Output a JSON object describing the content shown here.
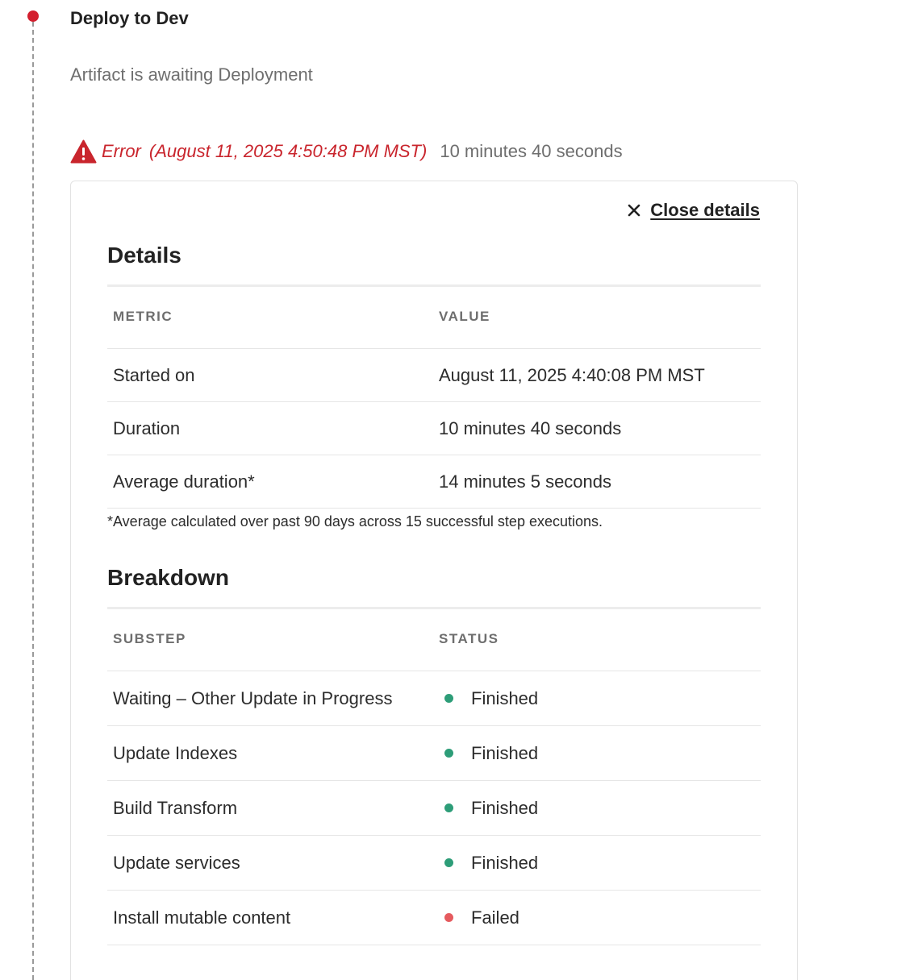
{
  "step": {
    "title": "Deploy to Dev",
    "subtitle": "Artifact is awaiting Deployment",
    "timeline_color": "#d31f2e"
  },
  "error": {
    "icon": "warning-triangle-icon",
    "label": "Error",
    "time": "(August 11, 2025 4:50:48 PM MST)",
    "duration": "10 minutes 40 seconds",
    "color": "#c9252d"
  },
  "details_panel": {
    "close_label": "Close details",
    "close_icon": "close-icon",
    "details": {
      "title": "Details",
      "headers": [
        "METRIC",
        "VALUE"
      ],
      "rows": [
        {
          "metric": "Started on",
          "value": "August 11, 2025 4:40:08 PM MST"
        },
        {
          "metric": "Duration",
          "value": "10 minutes 40 seconds"
        },
        {
          "metric": "Average duration*",
          "value": "14 minutes 5 seconds"
        }
      ],
      "footnote": "*Average calculated over past 90 days across 15 successful step executions."
    },
    "breakdown": {
      "title": "Breakdown",
      "headers": [
        "SUBSTEP",
        "STATUS"
      ],
      "rows": [
        {
          "substep": "Waiting – Other Update in Progress",
          "status": "Finished",
          "status_color": "#2d9d78"
        },
        {
          "substep": "Update Indexes",
          "status": "Finished",
          "status_color": "#2d9d78"
        },
        {
          "substep": "Build Transform",
          "status": "Finished",
          "status_color": "#2d9d78"
        },
        {
          "substep": "Update services",
          "status": "Finished",
          "status_color": "#2d9d78"
        },
        {
          "substep": "Install mutable content",
          "status": "Failed",
          "status_color": "#e55a5e"
        }
      ]
    }
  }
}
